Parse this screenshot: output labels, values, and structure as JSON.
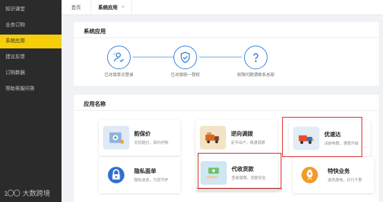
{
  "sidebar": {
    "items": [
      {
        "label": "知识课堂",
        "active": false
      },
      {
        "label": "业务订购",
        "active": false
      },
      {
        "label": "系统应用",
        "active": true
      },
      {
        "label": "建议反馈",
        "active": false
      },
      {
        "label": "订购数据",
        "active": false
      },
      {
        "label": "帮助客服问答",
        "active": false
      }
    ],
    "brand": {
      "logo": "1〇〇",
      "name": "大数跨境"
    }
  },
  "tabs": [
    {
      "label": "首页",
      "active": false
    },
    {
      "label": "系统应用",
      "active": true,
      "close": "×"
    }
  ],
  "process": {
    "title": "系统应用",
    "steps": [
      {
        "icon": "user-check-icon",
        "label": "已对接单点登录"
      },
      {
        "icon": "shield-check-icon",
        "label": "已对接统一授权"
      },
      {
        "icon": "question-icon",
        "label": "权限问题请联系总部"
      }
    ]
  },
  "apps": {
    "title": "应用名称",
    "cards": [
      {
        "title": "韵保价",
        "desc": "无忧赔付，保价护航",
        "icon": "safe-box-icon",
        "icon_bg": "#dfe9f7",
        "highlighted": false
      },
      {
        "title": "逆向调拨",
        "desc": "足不出户，极速调拨",
        "icon": "truck-icon",
        "icon_bg": "#f3e4c8",
        "highlighted": false
      },
      {
        "title": "优速达",
        "desc": "派前电联，满意升级",
        "icon": "delivery-truck-icon",
        "icon_bg": "#e3ecf5",
        "highlighted": true
      },
      {
        "title": "隐私面单",
        "desc": "隐私信息，为您守护",
        "icon": "lock-icon",
        "icon_bg": "#ffffff",
        "highlighted": false
      },
      {
        "title": "代收货款",
        "desc": "签收保障，货款安全",
        "icon": "cash-hand-icon",
        "icon_bg": "#cfe6f3",
        "highlighted": true
      },
      {
        "title": "特快业务",
        "desc": "选风提电，日行千里",
        "icon": "rocket-icon",
        "icon_bg": "#ffffff",
        "highlighted": false
      }
    ]
  },
  "colors": {
    "sidebar_bg": "#2b2b2b",
    "active_nav": "#f7ce0b",
    "accent_blue": "#2d7cd6",
    "highlight_red": "#d9211b"
  }
}
